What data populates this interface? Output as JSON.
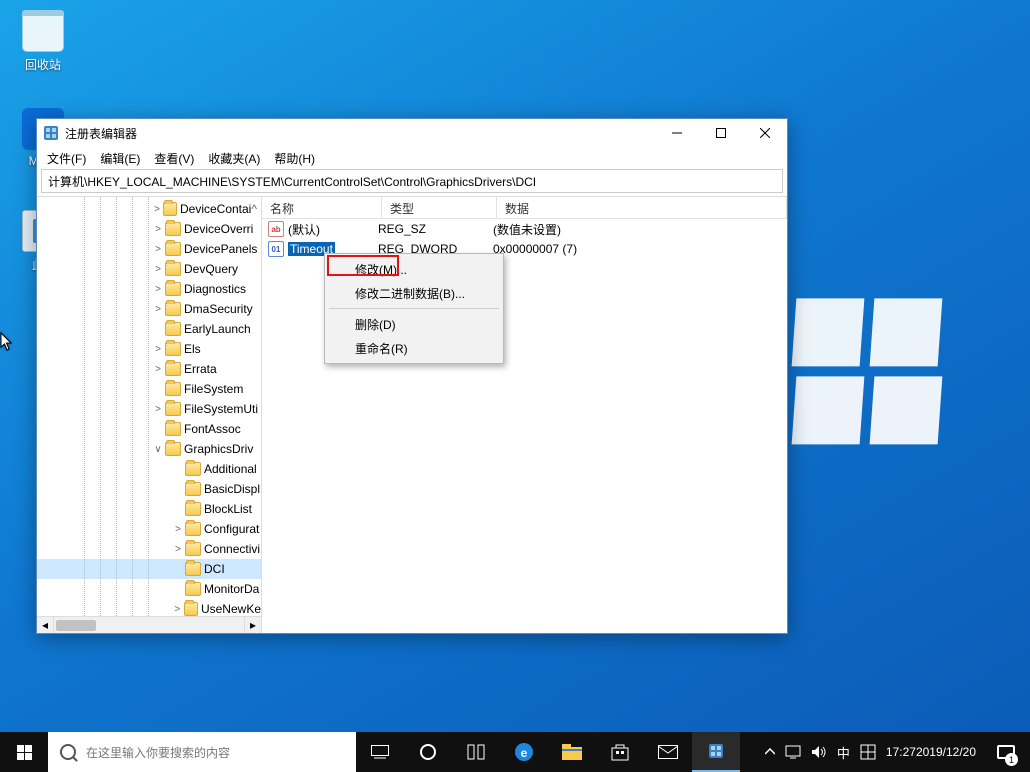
{
  "desktop": {
    "recycle": "回收站",
    "edge": "Mic...",
    "edge_letter": "e",
    "pc": "此...",
    "notif_count": "1"
  },
  "window": {
    "title": "注册表编辑器",
    "menu": {
      "file": "文件(F)",
      "edit": "编辑(E)",
      "view": "查看(V)",
      "fav": "收藏夹(A)",
      "help": "帮助(H)"
    },
    "address": "计算机\\HKEY_LOCAL_MACHINE\\SYSTEM\\CurrentControlSet\\Control\\GraphicsDrivers\\DCI",
    "columns": {
      "name": "名称",
      "type": "类型",
      "data": "数据"
    },
    "rows": [
      {
        "icon": "sz",
        "name": "(默认)",
        "type": "REG_SZ",
        "data": "(数值未设置)"
      },
      {
        "icon": "dw",
        "name": "Timeout",
        "type": "REG_DWORD",
        "data": "0x00000007 (7)"
      }
    ],
    "tree": [
      {
        "ind": 115,
        "exp": ">",
        "label": "DeviceContai",
        "up": "^"
      },
      {
        "ind": 115,
        "exp": ">",
        "label": "DeviceOverri"
      },
      {
        "ind": 115,
        "exp": ">",
        "label": "DevicePanels"
      },
      {
        "ind": 115,
        "exp": ">",
        "label": "DevQuery"
      },
      {
        "ind": 115,
        "exp": ">",
        "label": "Diagnostics"
      },
      {
        "ind": 115,
        "exp": ">",
        "label": "DmaSecurity"
      },
      {
        "ind": 115,
        "exp": "",
        "label": "EarlyLaunch"
      },
      {
        "ind": 115,
        "exp": ">",
        "label": "Els"
      },
      {
        "ind": 115,
        "exp": ">",
        "label": "Errata"
      },
      {
        "ind": 115,
        "exp": "",
        "label": "FileSystem"
      },
      {
        "ind": 115,
        "exp": ">",
        "label": "FileSystemUti"
      },
      {
        "ind": 115,
        "exp": "",
        "label": "FontAssoc"
      },
      {
        "ind": 115,
        "exp": "v",
        "label": "GraphicsDriv"
      },
      {
        "ind": 135,
        "exp": "",
        "label": "Additional"
      },
      {
        "ind": 135,
        "exp": "",
        "label": "BasicDispl"
      },
      {
        "ind": 135,
        "exp": "",
        "label": "BlockList"
      },
      {
        "ind": 135,
        "exp": ">",
        "label": "Configurat"
      },
      {
        "ind": 135,
        "exp": ">",
        "label": "Connectivi"
      },
      {
        "ind": 135,
        "exp": "",
        "label": "DCI",
        "sel": true
      },
      {
        "ind": 135,
        "exp": "",
        "label": "MonitorDa"
      },
      {
        "ind": 135,
        "exp": ">",
        "label": "UseNewKe"
      }
    ]
  },
  "context": {
    "modify": "修改(M)...",
    "modbin": "修改二进制数据(B)...",
    "delete": "删除(D)",
    "rename": "重命名(R)"
  },
  "taskbar": {
    "search_placeholder": "在这里输入你要搜索的内容",
    "ime": "中",
    "ime2": "田",
    "time": "17:27",
    "date": "2019/12/20"
  }
}
